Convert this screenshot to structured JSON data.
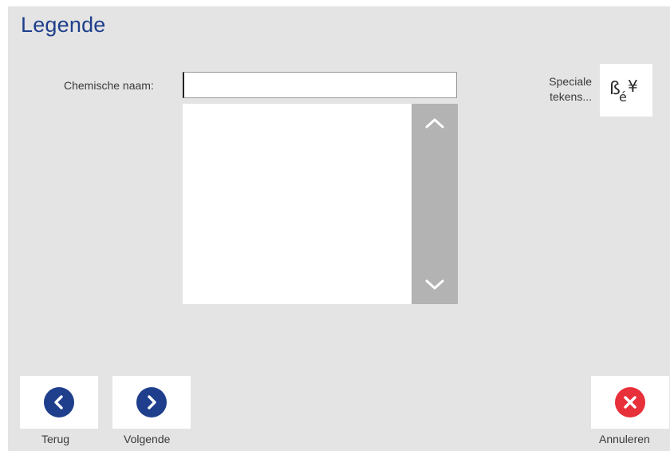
{
  "header": {
    "title": "Legende"
  },
  "form": {
    "chemical_name_label": "Chemische naam:",
    "chemical_name_value": "",
    "chemical_name_placeholder": "",
    "list_items": []
  },
  "special_chars": {
    "label_line1": "Speciale",
    "label_line2": "tekens...",
    "icon_text_main": "ß",
    "icon_text_accent": "é",
    "icon_text_currency": "¥"
  },
  "footer": {
    "back_label": "Terug",
    "next_label": "Volgende",
    "cancel_label": "Annuleren"
  },
  "icons": {
    "back": "chevron-left-icon",
    "next": "chevron-right-icon",
    "cancel": "close-icon",
    "scroll_up": "chevron-up-icon",
    "scroll_down": "chevron-down-icon",
    "special_chars": "special-characters-icon"
  },
  "colors": {
    "title": "#1f3f8c",
    "background": "#e4e4e4",
    "nav_circle": "#1f3f8c",
    "cancel_circle": "#e8303a",
    "scrollbar": "#b3b3b3"
  }
}
